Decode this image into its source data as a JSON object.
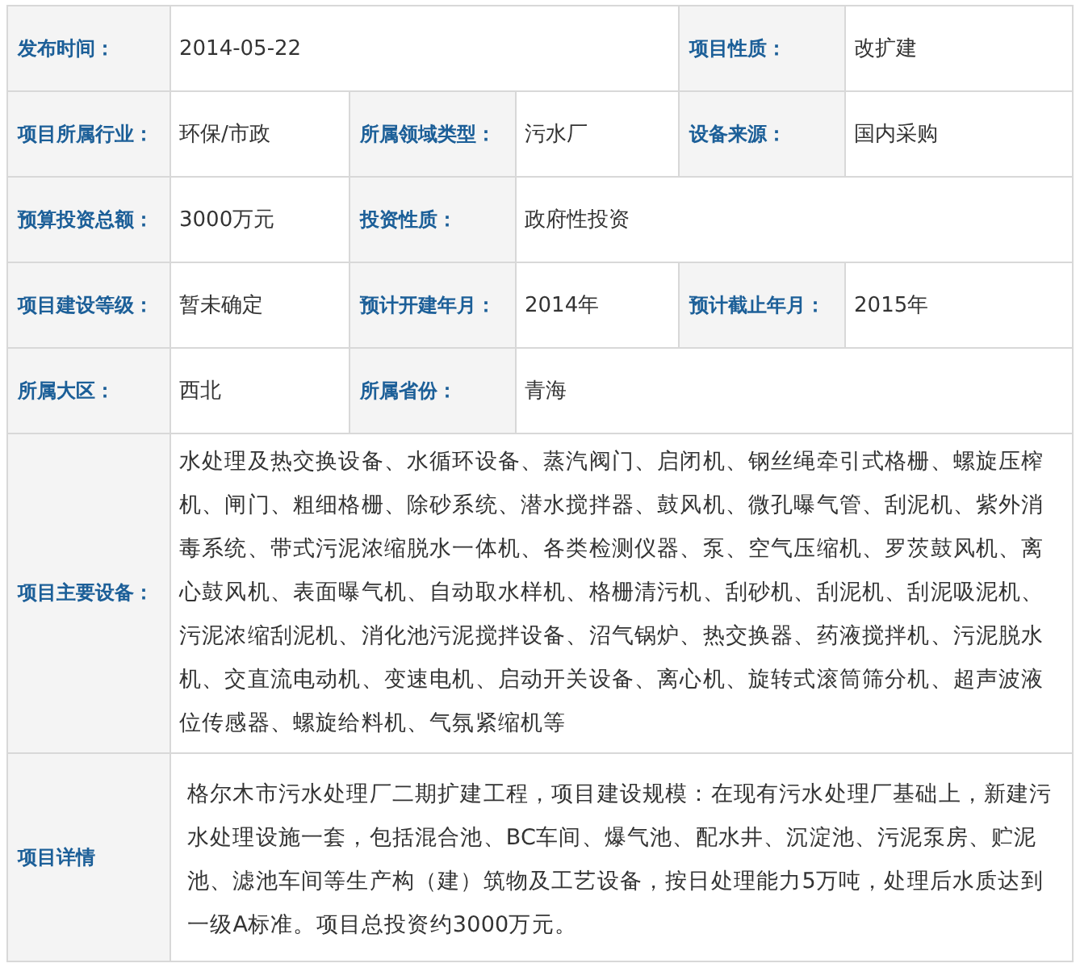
{
  "rows": [
    {
      "fields": [
        {
          "label": "发布时间：",
          "value": "2014-05-22",
          "wide": true
        },
        {
          "label": "项目性质：",
          "value": "改扩建",
          "wide": false
        }
      ]
    },
    {
      "fields": [
        {
          "label": "项目所属行业：",
          "value": "环保/市政",
          "wide": false
        },
        {
          "label": "所属领域类型：",
          "value": "污水厂",
          "wide": false
        },
        {
          "label": "设备来源：",
          "value": "国内采购",
          "wide": false
        }
      ]
    },
    {
      "fields": [
        {
          "label": "预算投资总额：",
          "value": "3000万元",
          "wide": false
        },
        {
          "label": "投资性质：",
          "value": "政府性投资",
          "wide": true
        }
      ]
    },
    {
      "fields": [
        {
          "label": "项目建设等级：",
          "value": "暂未确定",
          "wide": false
        },
        {
          "label": "预计开建年月：",
          "value": "2014年",
          "wide": false
        },
        {
          "label": "预计截止年月：",
          "value": "2015年",
          "wide": false
        }
      ]
    },
    {
      "fields": [
        {
          "label": "所属大区：",
          "value": "西北",
          "wide": false
        },
        {
          "label": "所属省份：",
          "value": "青海",
          "wide": true
        }
      ]
    },
    {
      "fields": [
        {
          "label": "项目主要设备：",
          "value": "水处理及热交换设备、水循环设备、蒸汽阀门、启闭机、钢丝绳牵引式格栅、螺旋压榨机、闸门、粗细格栅、除砂系统、潜水搅拌器、鼓风机、微孔曝气管、刮泥机、紫外消毒系统、带式污泥浓缩脱水一体机、各类检测仪器、泵、空气压缩机、罗茨鼓风机、离心鼓风机、表面曝气机、自动取水样机、格栅清污机、刮砂机、刮泥机、刮泥吸泥机、污泥浓缩刮泥机、消化池污泥搅拌设备、沼气锅炉、热交换器、药液搅拌机、污泥脱水机、交直流电动机、变速电机、启动开关设备、离心机、旋转式滚筒筛分机、超声波液位传感器、螺旋给料机、气氛紧缩机等",
          "wide": true
        }
      ]
    },
    {
      "fields": [
        {
          "label": "项目详情",
          "value": "格尔木市污水处理厂二期扩建工程，项目建设规模：在现有污水处理厂基础上，新建污水处理设施一套，包括混合池、BC车间、爆气池、配水井、沉淀池、污泥泵房、贮泥池、滤池车间等生产构（建）筑物及工艺设备，按日处理能力5万吨，处理后水质达到一级A标准。项目总投资约3000万元。",
          "wide": true
        }
      ]
    }
  ]
}
